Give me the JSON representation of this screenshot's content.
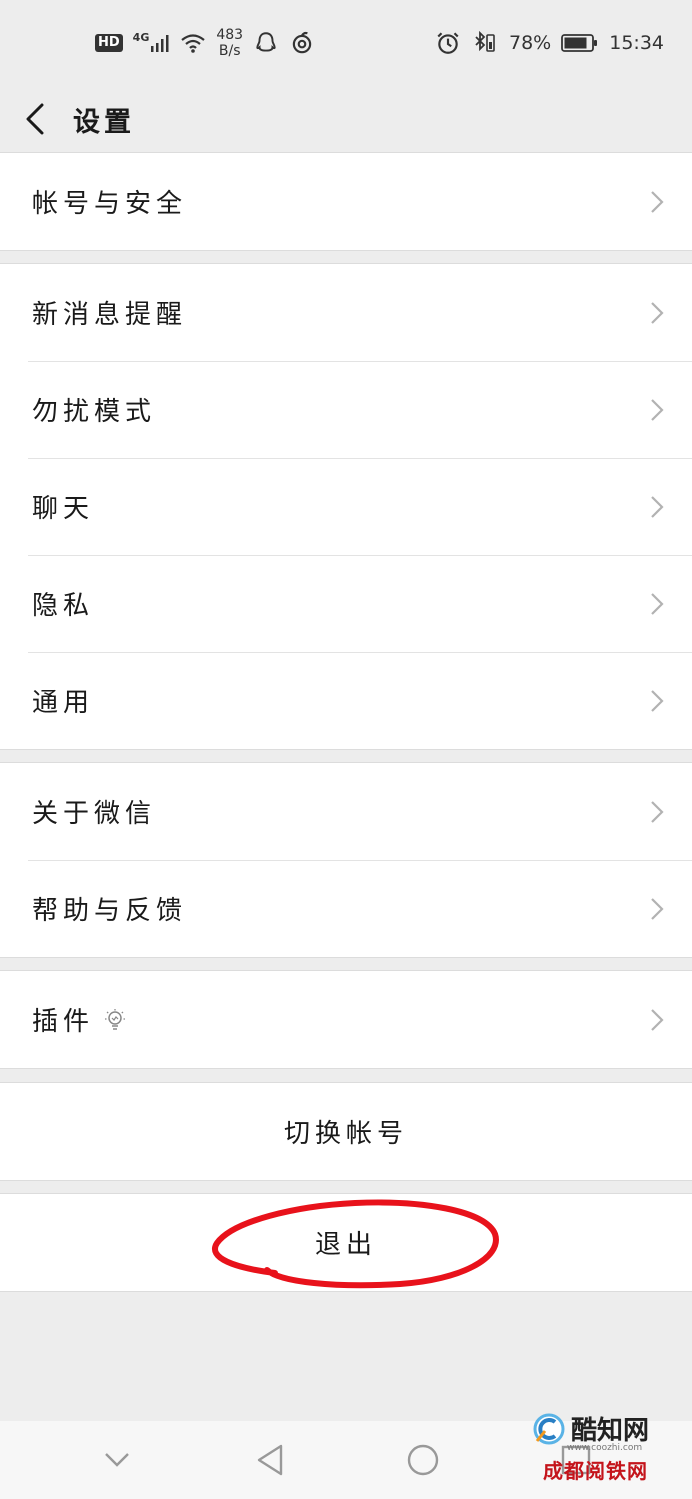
{
  "status_bar": {
    "hd": "HD",
    "network": "4G",
    "speed_value": "483",
    "speed_unit": "B/s",
    "battery_percent": "78%",
    "time": "15:34"
  },
  "header": {
    "title": "设置"
  },
  "groups": [
    {
      "items": [
        {
          "label": "帐号与安全"
        }
      ]
    },
    {
      "items": [
        {
          "label": "新消息提醒"
        },
        {
          "label": "勿扰模式"
        },
        {
          "label": "聊天"
        },
        {
          "label": "隐私"
        },
        {
          "label": "通用"
        }
      ]
    },
    {
      "items": [
        {
          "label": "关于微信"
        },
        {
          "label": "帮助与反馈"
        }
      ]
    },
    {
      "items": [
        {
          "label": "插件",
          "icon": "lightbulb-icon"
        }
      ]
    }
  ],
  "actions": {
    "switch_account": "切换帐号",
    "logout": "退出"
  },
  "annotation": {
    "color": "#e8121b"
  },
  "watermark": {
    "name": "酷知网",
    "url": "www.coozhi.com",
    "secondary": "成都阅铁网"
  },
  "icons": {
    "back": "chevron-left-icon",
    "row": "chevron-right-icon",
    "nav": [
      "chevron-down-icon",
      "triangle-back-icon",
      "circle-home-icon",
      "square-recents-icon"
    ]
  }
}
